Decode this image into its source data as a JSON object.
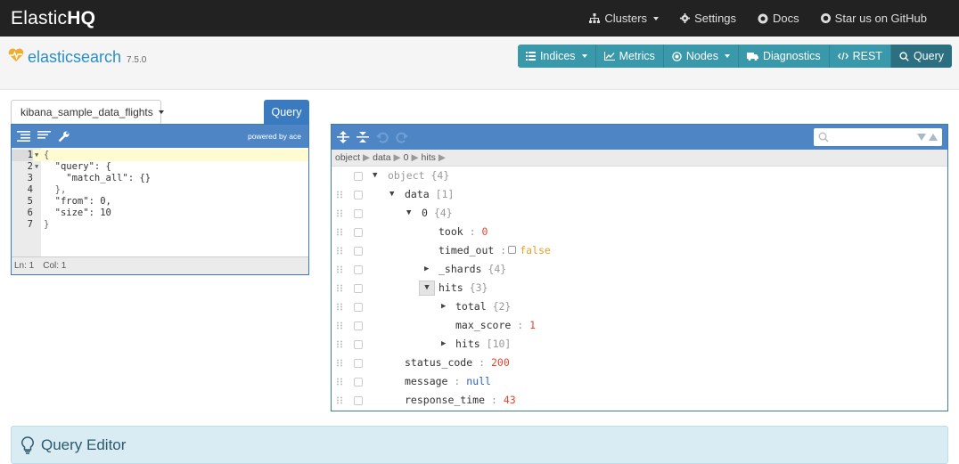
{
  "app": {
    "brand_light": "Elastic",
    "brand_bold": "HQ"
  },
  "topnav": {
    "clusters": "Clusters",
    "settings": "Settings",
    "docs": "Docs",
    "github": "Star us on GitHub"
  },
  "cluster": {
    "name": "elasticsearch",
    "version": "7.5.0"
  },
  "mainnav": {
    "indices": "Indices",
    "metrics": "Metrics",
    "nodes": "Nodes",
    "diagnostics": "Diagnostics",
    "rest": "REST",
    "query": "Query"
  },
  "query": {
    "index": "kibana_sample_data_flights",
    "button": "Query"
  },
  "editor": {
    "powered_by": "powered by ace",
    "status_ln": "Ln: 1",
    "status_col": "Col: 1",
    "lines": [
      {
        "n": "1",
        "text": "{"
      },
      {
        "n": "2",
        "text": "  \"query\": {"
      },
      {
        "n": "3",
        "text": "    \"match_all\": {}"
      },
      {
        "n": "4",
        "text": "  },"
      },
      {
        "n": "5",
        "text": "  \"from\": 0,"
      },
      {
        "n": "6",
        "text": "  \"size\": 10"
      },
      {
        "n": "7",
        "text": "}"
      }
    ]
  },
  "result": {
    "breadcrumb": [
      "object",
      "data",
      "0",
      "hits"
    ],
    "tree": {
      "root_key": "object",
      "root_meta": "{4}",
      "data_key": "data",
      "data_meta": "[1]",
      "zero_key": "0",
      "zero_meta": "{4}",
      "took_key": "took",
      "took_val": "0",
      "timed_out_key": "timed_out",
      "timed_out_val": "false",
      "shards_key": "_shards",
      "shards_meta": "{4}",
      "hits_key": "hits",
      "hits_meta": "{3}",
      "total_key": "total",
      "total_meta": "{2}",
      "max_score_key": "max_score",
      "max_score_val": "1",
      "hits_inner_key": "hits",
      "hits_inner_meta": "[10]",
      "status_code_key": "status_code",
      "status_code_val": "200",
      "message_key": "message",
      "message_val": "null",
      "response_time_key": "response_time",
      "response_time_val": "43"
    }
  },
  "info": {
    "title": "Query Editor"
  },
  "colors": {
    "topbar": "#222222",
    "accent": "#3a98ab",
    "active": "#2b6f80",
    "editor_blue": "#4e86c5",
    "info_bg": "#d9ecf3"
  }
}
